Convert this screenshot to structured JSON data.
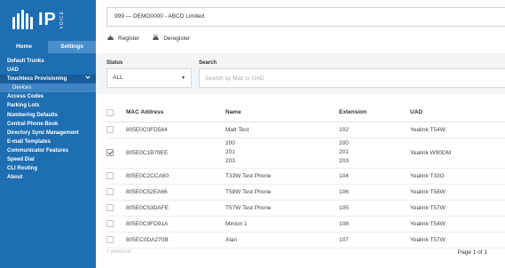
{
  "logo": {
    "text": "IP",
    "subtext": "VOICE"
  },
  "side_tabs": [
    "Home",
    "Settings"
  ],
  "menu": {
    "default_trunks": "Default Trunks",
    "uad": "UAD",
    "touchless": "Touchless Provisioning",
    "devices": "Devices",
    "access_codes": "Access Codes",
    "parking_lots": "Parking Lots",
    "numbering_defaults": "Numbering Defaults",
    "central_phone_book": "Central Phone Book",
    "directory_sync": "Directory Sync Management",
    "email_templates": "E-mail Templates",
    "communicator_features": "Communicator Features",
    "speed_dial": "Speed Dial",
    "cli_routing": "CLI Routing",
    "about": "About"
  },
  "topbar": {
    "account": "999  —  DEMO0000 - ABCD Limited"
  },
  "actions": {
    "register": "Register",
    "deregister": "Deregister"
  },
  "filters": {
    "status_label": "Status",
    "status_value": "ALL",
    "search_label": "Search",
    "search_placeholder": "Search by Mac or UAD"
  },
  "table": {
    "headers": {
      "mac": "MAC Address",
      "name": "Name",
      "extension": "Extension",
      "uad": "UAD"
    },
    "rows": [
      {
        "mac": "805E0C0FD584",
        "name": "Matt Test",
        "ext": "102",
        "uad": "Yealink T54W",
        "checked": false
      },
      {
        "mac": "805E0C1B79EE",
        "name": [
          "200",
          "201",
          "203"
        ],
        "ext": [
          "200",
          "201",
          "203"
        ],
        "uad": "Yealink W90DM",
        "checked": true
      },
      {
        "mac": "805E0C2CCA60",
        "name": "T33W Test Phone",
        "ext": "104",
        "uad": "Yealink T33G",
        "checked": false
      },
      {
        "mac": "805E0C52EA66",
        "name": "T58W Test Phone",
        "ext": "106",
        "uad": "Yealink T58W",
        "checked": false
      },
      {
        "mac": "805E0C53DAFE",
        "name": "T57W Test Phone",
        "ext": "105",
        "uad": "Yealink T57W",
        "checked": false
      },
      {
        "mac": "805E0C9FD91A",
        "name": "Minion 1",
        "ext": "108",
        "uad": "Yealink T54W",
        "checked": false
      },
      {
        "mac": "805EC0DA270B",
        "name": "Alan",
        "ext": "107",
        "uad": "Yealink T57W",
        "checked": false
      }
    ]
  },
  "pager": {
    "prev": "< previous",
    "info": "Page 1 of 1"
  }
}
